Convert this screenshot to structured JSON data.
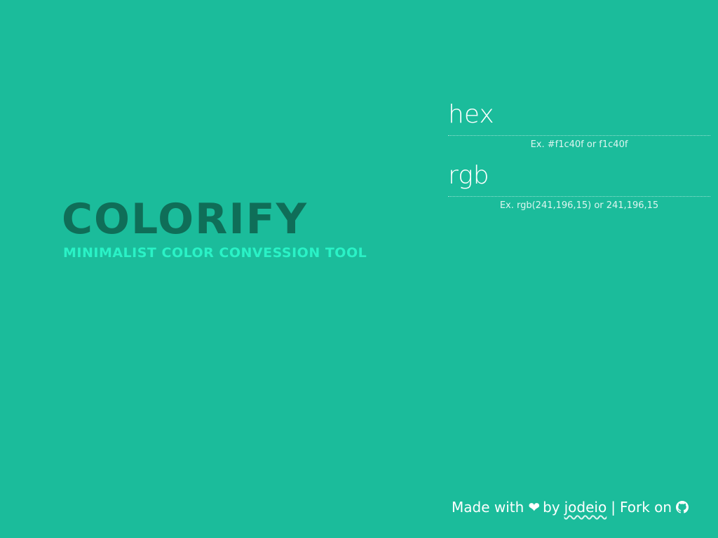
{
  "brand": {
    "title": "COLORIFY",
    "subtitle": "MINIMALIST COLOR CONVESSION TOOL"
  },
  "fields": [
    {
      "placeholder": "hex",
      "value": "",
      "hint": "Ex. #f1c40f or f1c40f"
    },
    {
      "placeholder": "rgb",
      "value": "",
      "hint": "Ex. rgb(241,196,15) or 241,196,15"
    }
  ],
  "footer": {
    "made_with": "Made with",
    "heart_icon": "heart-icon",
    "by": "by",
    "author": "jodeio",
    "separator": "|",
    "fork_label": "Fork on",
    "github_icon": "github-icon"
  },
  "colors": {
    "background": "#1bbc9b",
    "title": "#0f6e58",
    "subtitle": "#2af2c6",
    "text": "#ffffff"
  }
}
